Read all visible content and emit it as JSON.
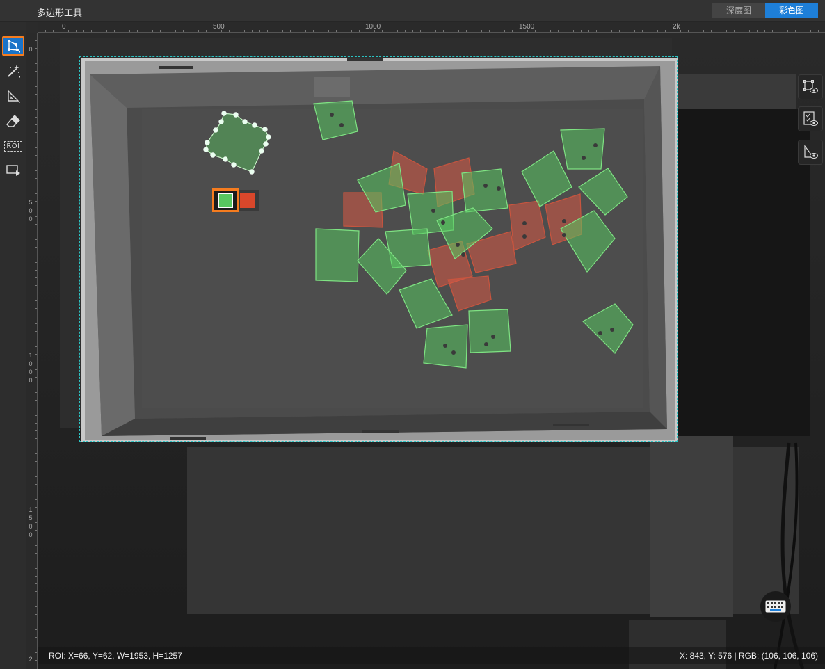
{
  "window": {
    "title": "多边形工具"
  },
  "view_tabs": [
    {
      "label": "深度图",
      "active": false
    },
    {
      "label": "彩色图",
      "active": true
    }
  ],
  "toolbar": [
    {
      "name": "polygon-tool",
      "icon": "polygon-icon",
      "active": true
    },
    {
      "name": "magic-wand-tool",
      "icon": "magic-wand-icon",
      "active": false
    },
    {
      "name": "ruler-tool",
      "icon": "triangle-ruler-icon",
      "active": false
    },
    {
      "name": "eraser-tool",
      "icon": "eraser-icon",
      "active": false
    },
    {
      "name": "roi-tool",
      "icon": "roi-icon",
      "label": "ROI",
      "active": false
    },
    {
      "name": "play-tool",
      "icon": "frame-play-icon",
      "active": false
    }
  ],
  "ruler": {
    "top_labels": [
      "0",
      "500",
      "1000",
      "1500",
      "2k"
    ],
    "left_labels": [
      "0",
      "500",
      "1000",
      "1500",
      "2"
    ]
  },
  "right_tools": [
    {
      "name": "show-polygon-button",
      "icon": "polygon-eye-icon"
    },
    {
      "name": "show-list-button",
      "icon": "checklist-eye-icon"
    },
    {
      "name": "show-mask-button",
      "icon": "ruler-eye-icon"
    }
  ],
  "colors": {
    "accent": "#1e7fd8",
    "active_border": "#f57c1f",
    "label_green": "#58c760",
    "label_red": "#d9472b",
    "roi_border": "#2bc4c4"
  },
  "color_picker": {
    "selected": "green"
  },
  "status": {
    "roi": "ROI: X=66, Y=62, W=1953, H=1257",
    "cursor": "X: 843, Y: 576 | RGB: (106, 106, 106)"
  }
}
